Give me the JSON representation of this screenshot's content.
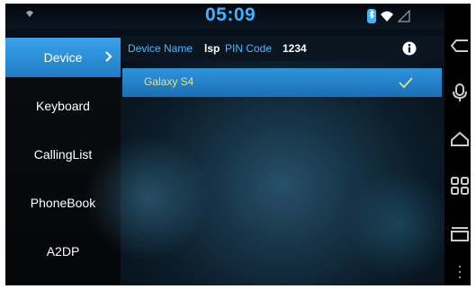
{
  "status": {
    "time": "05:09"
  },
  "sidebar": {
    "items": [
      {
        "label": "Device",
        "active": true
      },
      {
        "label": "Keyboard",
        "active": false
      },
      {
        "label": "CallingList",
        "active": false
      },
      {
        "label": "PhoneBook",
        "active": false
      },
      {
        "label": "A2DP",
        "active": false
      }
    ]
  },
  "header": {
    "device_name_label": "Device Name",
    "device_name_value": "lsp",
    "pin_label": "PIN Code",
    "pin_value": "1234"
  },
  "devices": [
    {
      "name": "Galaxy S4",
      "selected": true
    }
  ],
  "colors": {
    "accent": "#2e93dc",
    "clock": "#3fb3ff",
    "device_name": "#e8e27a"
  },
  "icons": {
    "status": [
      "wifi-icon",
      "bluetooth-icon",
      "wifi-icon",
      "signal-icon"
    ],
    "nav": [
      "back-icon",
      "microphone-icon",
      "home-icon",
      "apps-icon",
      "recents-icon",
      "more-icon"
    ]
  }
}
